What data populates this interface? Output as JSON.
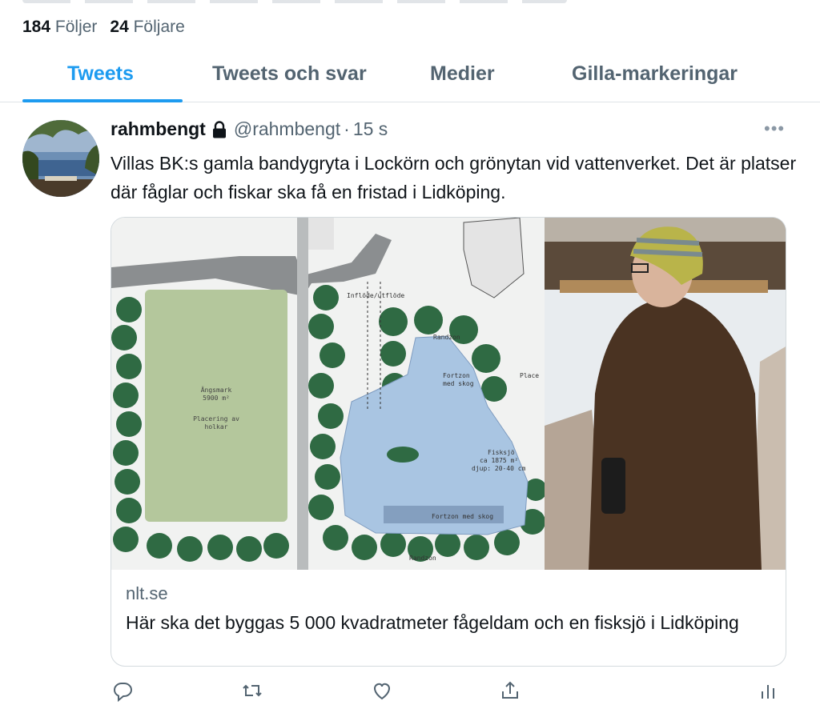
{
  "profile": {
    "following_count": "184",
    "following_label": "Följer",
    "followers_count": "24",
    "followers_label": "Följare"
  },
  "tabs": [
    {
      "label": "Tweets",
      "active": true
    },
    {
      "label": "Tweets och svar",
      "active": false
    },
    {
      "label": "Medier",
      "active": false
    },
    {
      "label": "Gilla-markeringar",
      "active": false
    }
  ],
  "tweet": {
    "display_name": "rahmbengt",
    "protected_icon": "lock-icon",
    "handle": "@rahmbengt",
    "separator": "·",
    "timestamp": "15 s",
    "more_icon": "more-icon",
    "text": "Villas BK:s gamla bandygryta i Lockörn och grönytan vid vattenverket. Det är platser där fåglar och fiskar ska få en fristad i Lidköping.",
    "card": {
      "domain": "nlt.se",
      "title": "Här ska det byggas 5 000 kvadratmeter fågeldam och en fisksjö i Lidköping",
      "plan_labels": {
        "inflow": "Inflöde/utflöde",
        "meadow": "Ängsmark",
        "meadow_area": "5900 m²",
        "nest_boxes": "Placering av",
        "nest_boxes_2": "holkar",
        "edge_zone": "Randzon",
        "feeding": "Fortzon",
        "feeding_2": "med skog",
        "place": "Place",
        "lake": "Fisksjö",
        "lake_area": "ca 1875 m²",
        "lake_depth": "djup: 20-40 cm",
        "bottom_zone": "Randzon",
        "shallow_zone": "Fortzon med skog"
      }
    },
    "actions": [
      "reply-icon",
      "retweet-icon",
      "like-icon",
      "share-icon",
      "analytics-icon"
    ]
  }
}
